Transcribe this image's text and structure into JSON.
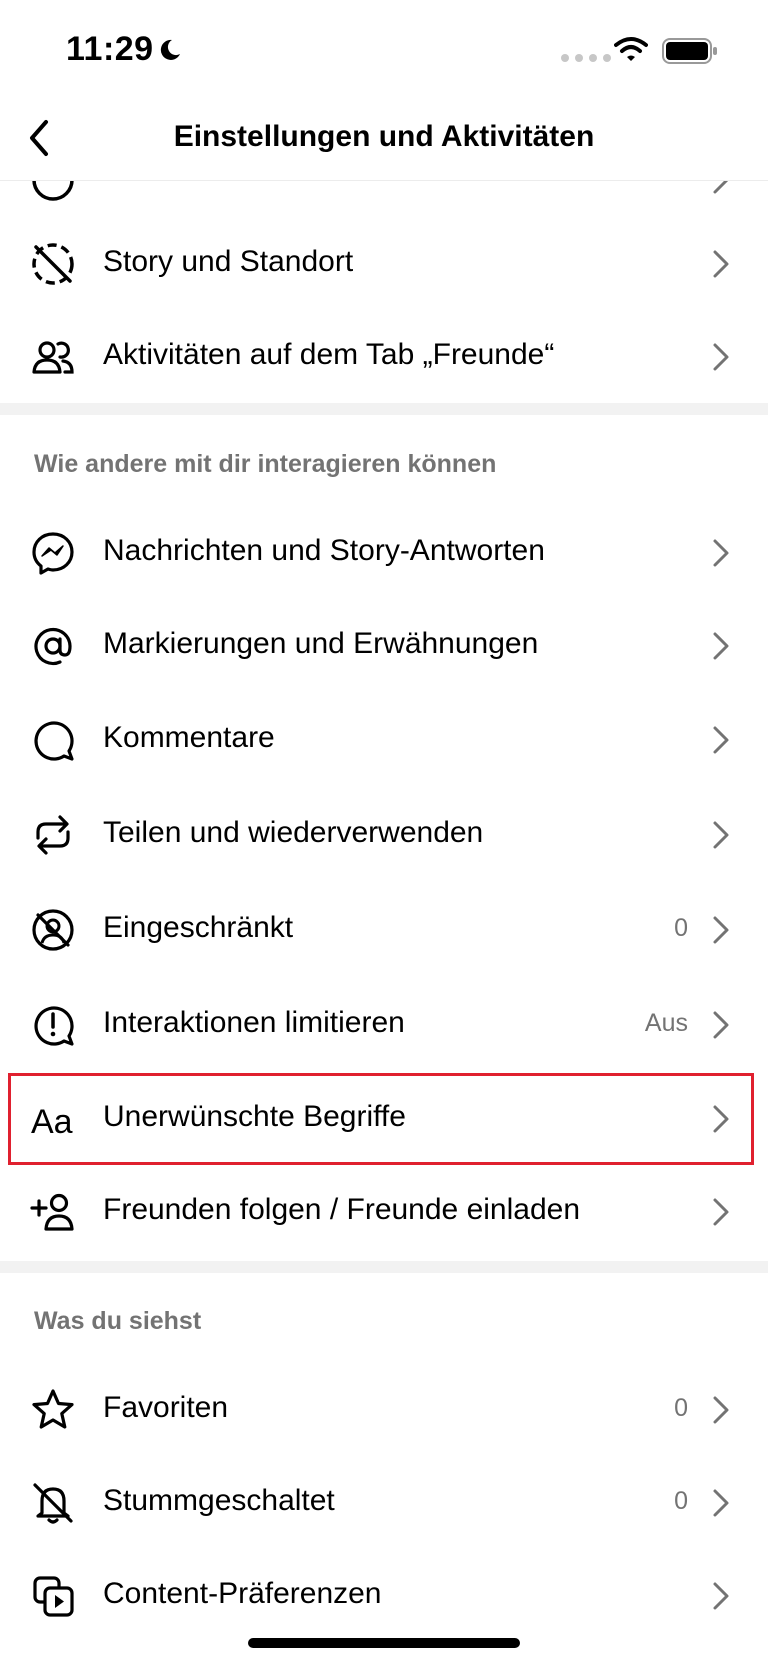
{
  "status_bar": {
    "time": "11:29"
  },
  "nav": {
    "title": "Einstellungen und Aktivitäten"
  },
  "rows_top": [
    {
      "label": "Story und Standort",
      "icon": "story-off-icon",
      "value": ""
    },
    {
      "label": "Aktivitäten auf dem Tab „Freunde“",
      "icon": "people-icon",
      "value": ""
    }
  ],
  "section_interact": {
    "header": "Wie andere mit dir interagieren können",
    "items": [
      {
        "label": "Nachrichten und Story-Antworten",
        "icon": "messenger-icon",
        "value": ""
      },
      {
        "label": "Markierungen und Erwähnungen",
        "icon": "at-icon",
        "value": ""
      },
      {
        "label": "Kommentare",
        "icon": "comment-icon",
        "value": ""
      },
      {
        "label": "Teilen und wiederverwenden",
        "icon": "share-reuse-icon",
        "value": ""
      },
      {
        "label": "Eingeschränkt",
        "icon": "restricted-icon",
        "value": "0"
      },
      {
        "label": "Interaktionen limitieren",
        "icon": "limit-icon",
        "value": "Aus"
      },
      {
        "label": "Unerwünschte Begriffe",
        "icon": "text-aa-icon",
        "value": ""
      },
      {
        "label": "Freunden folgen / Freunde einladen",
        "icon": "add-person-icon",
        "value": ""
      }
    ]
  },
  "section_see": {
    "header": "Was du siehst",
    "items": [
      {
        "label": "Favoriten",
        "icon": "star-icon",
        "value": "0"
      },
      {
        "label": "Stummgeschaltet",
        "icon": "bell-off-icon",
        "value": "0"
      },
      {
        "label": "Content-Präferenzen",
        "icon": "media-icon",
        "value": ""
      }
    ]
  }
}
